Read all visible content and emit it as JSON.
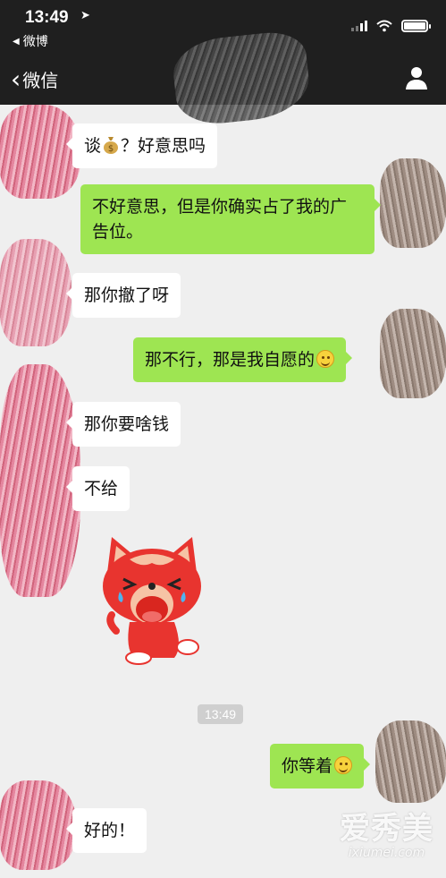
{
  "status_bar": {
    "time": "13:49",
    "back_source": "微博"
  },
  "nav": {
    "back_label": "微信"
  },
  "messages": [
    {
      "side": "in",
      "text_before": "谈",
      "text_after": "？好意思吗"
    },
    {
      "side": "out",
      "text": "不好意思，但是你确实占了我的广告位。"
    },
    {
      "side": "in",
      "text": "那你撤了呀"
    },
    {
      "side": "out",
      "text": "那不行，那是我自愿的"
    },
    {
      "side": "in",
      "text": "那你要啥钱"
    },
    {
      "side": "in",
      "text": "不给"
    },
    {
      "side": "in",
      "type": "sticker",
      "sticker": "crying-red-fox"
    },
    {
      "type": "time",
      "text": "13:49"
    },
    {
      "side": "out",
      "text": "你等着"
    },
    {
      "side": "in",
      "text": "好的！"
    }
  ],
  "watermark": {
    "cn": "爱秀美",
    "en": "ixiumei.com"
  },
  "colors": {
    "header": "#1f1f1f",
    "chat_bg": "#efefef",
    "out_bubble": "#9ee552",
    "in_bubble": "#ffffff"
  }
}
